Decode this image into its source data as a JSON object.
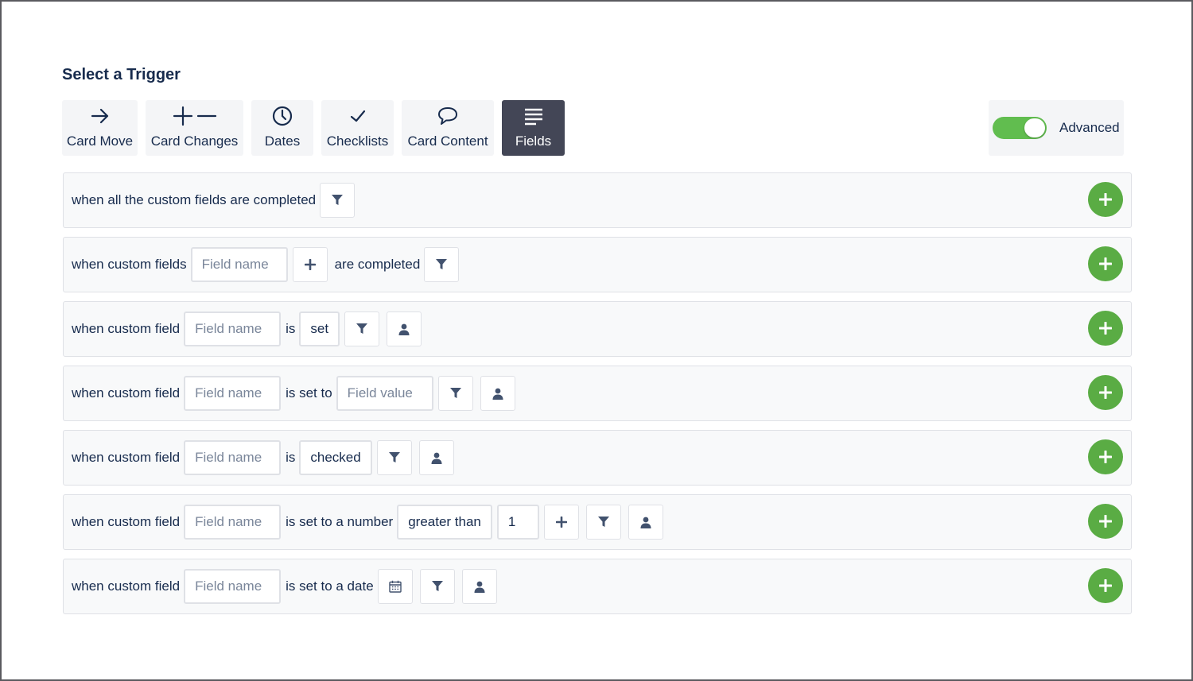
{
  "page": {
    "title": "Select a Trigger"
  },
  "tabs": [
    {
      "label": "Card Move",
      "icon": "arrow-right-icon"
    },
    {
      "label": "Card Changes",
      "icon": "plus-minus-icon"
    },
    {
      "label": "Dates",
      "icon": "clock-icon"
    },
    {
      "label": "Checklists",
      "icon": "check-icon"
    },
    {
      "label": "Card Content",
      "icon": "speech-bubble-icon"
    },
    {
      "label": "Fields",
      "icon": "lines-icon",
      "active": true
    }
  ],
  "advanced": {
    "label": "Advanced",
    "on": true
  },
  "colors": {
    "accent": "#5aac44",
    "toggle": "#61bd4f",
    "active_tab": "#434656",
    "text": "#172b4d"
  },
  "triggers": {
    "r1": {
      "t1": "when all the custom fields are completed"
    },
    "r2": {
      "t1": "when custom fields",
      "field_placeholder": "Field name",
      "t2": "are completed"
    },
    "r3": {
      "t1": "when custom field",
      "field_placeholder": "Field name",
      "t2": "is",
      "state": "set"
    },
    "r4": {
      "t1": "when custom field",
      "field_placeholder": "Field name",
      "t2": "is set to",
      "value_placeholder": "Field value"
    },
    "r5": {
      "t1": "when custom field",
      "field_placeholder": "Field name",
      "t2": "is",
      "state": "checked"
    },
    "r6": {
      "t1": "when custom field",
      "field_placeholder": "Field name",
      "t2": "is set to a number",
      "comparison": "greater than",
      "number": "1"
    },
    "r7": {
      "t1": "when custom field",
      "field_placeholder": "Field name",
      "t2": "is set to a date"
    }
  }
}
